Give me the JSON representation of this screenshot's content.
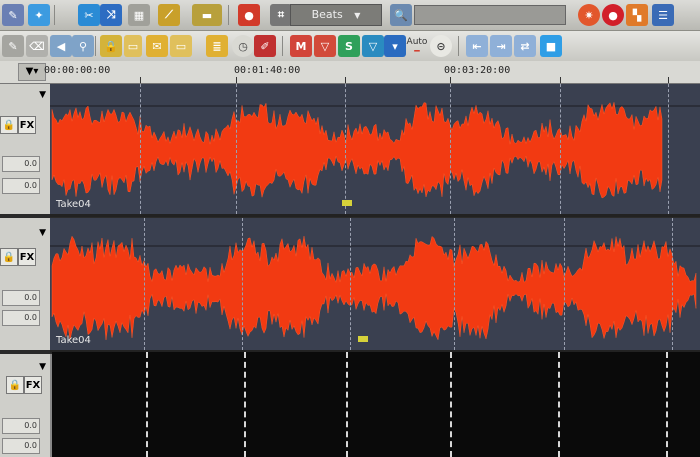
{
  "toolbar": {
    "snap_mode_value": "Beats",
    "auto_label": "Auto",
    "marker_button_label": "M"
  },
  "ruler": {
    "labels": [
      "00:00:00:00",
      "00:01:40:00",
      "00:03:20:00"
    ]
  },
  "tracks": [
    {
      "clip_name": "Take04",
      "fx_label": "FX",
      "vol_value": "0.0",
      "pan_value": "0.0"
    },
    {
      "clip_name": "Take04",
      "fx_label": "FX",
      "vol_value": "0.0",
      "pan_value": "0.0"
    },
    {
      "clip_name": "",
      "fx_label": "FX",
      "vol_value": "0.0",
      "pan_value": "0.0"
    }
  ],
  "colors": {
    "waveform": "#f23a12",
    "lane_background": "#3c4252",
    "empty_lane": "#0a0a0a"
  }
}
